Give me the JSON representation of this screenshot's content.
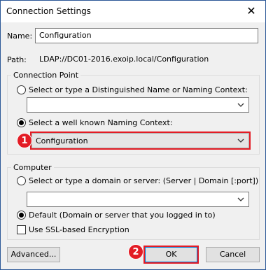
{
  "window": {
    "title": "Connection Settings"
  },
  "name": {
    "label": "Name:",
    "value": "Configuration"
  },
  "path": {
    "label": "Path:",
    "value": "LDAP://DC01-2016.exoip.local/Configuration"
  },
  "connection_point": {
    "title": "Connection Point",
    "option_dn_label": "Select or type a Distinguished Name or Naming Context:",
    "option_dn_selected": false,
    "dn_value": "",
    "option_known_label": "Select a well known Naming Context:",
    "option_known_selected": true,
    "known_value": "Configuration"
  },
  "computer": {
    "title": "Computer",
    "option_server_label": "Select or type a domain or server: (Server | Domain [:port])",
    "option_server_selected": false,
    "server_value": "",
    "option_default_label": "Default (Domain or server that you logged in to)",
    "option_default_selected": true,
    "ssl_label": "Use SSL-based Encryption",
    "ssl_checked": false
  },
  "buttons": {
    "advanced": "Advanced...",
    "ok": "OK",
    "cancel": "Cancel"
  },
  "annotations": {
    "badge1": "1",
    "badge2": "2",
    "accent_color": "#e31c25"
  }
}
